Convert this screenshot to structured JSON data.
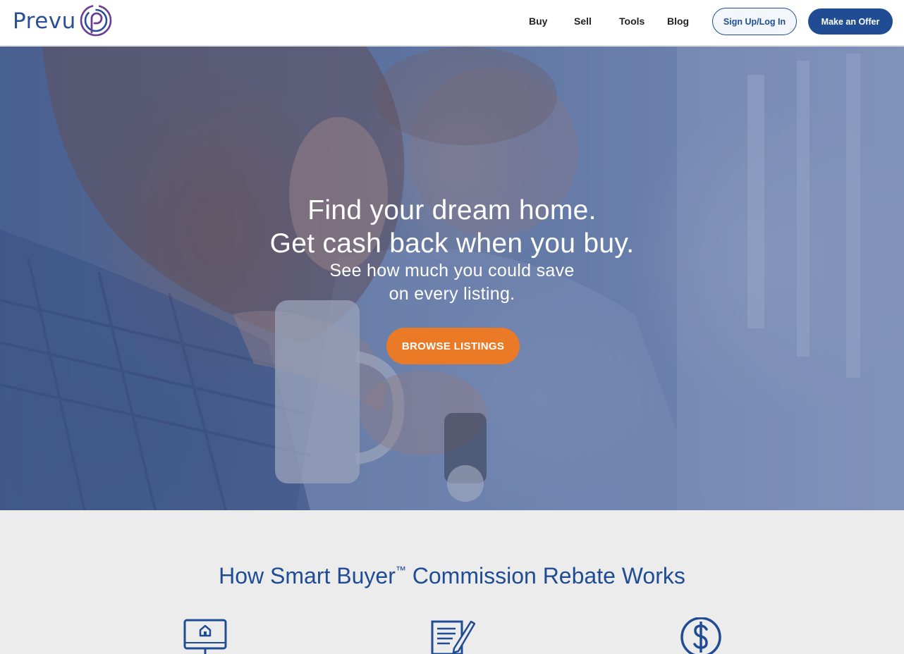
{
  "header": {
    "logo_text": "Prevu",
    "nav": [
      {
        "label": "Buy"
      },
      {
        "label": "Sell"
      },
      {
        "label": "Tools"
      },
      {
        "label": "Blog"
      }
    ],
    "signup_label": "Sign Up/Log In",
    "offer_label": "Make an Offer"
  },
  "hero": {
    "title_line1": "Find your dream home.",
    "title_line2": "Get cash back when you buy.",
    "sub_line1": "See how much you could save",
    "sub_line2": "on every listing.",
    "cta_label": "BROWSE LISTINGS"
  },
  "section": {
    "title_part1": "How Smart Buyer",
    "trademark": "™",
    "title_part2": " Commission Rebate Works",
    "steps": [
      {
        "icon": "computer-house-icon"
      },
      {
        "icon": "document-pencil-icon"
      },
      {
        "icon": "dollar-circle-icon"
      }
    ]
  },
  "colors": {
    "brand_blue": "#1f4c93",
    "cta_orange": "#ea7a26",
    "logo_purple": "#6a3f93"
  }
}
